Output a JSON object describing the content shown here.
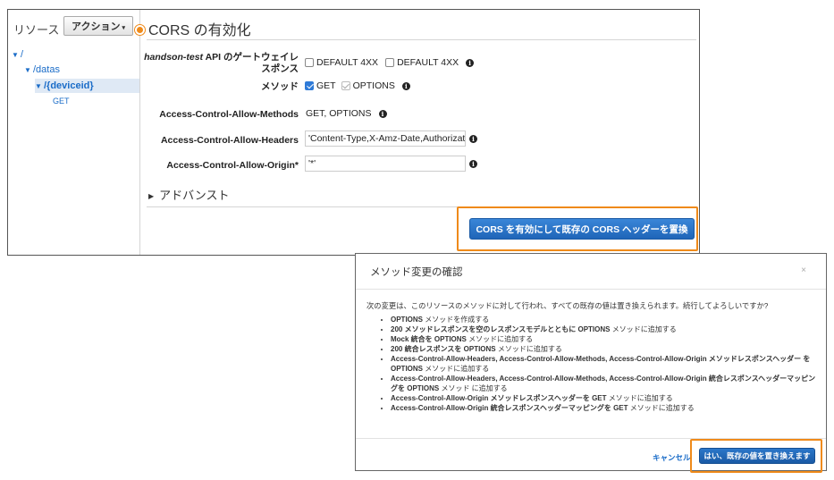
{
  "resources": {
    "title": "リソース",
    "action_button": "アクション",
    "tree": [
      {
        "label": "/"
      },
      {
        "label": "/datas"
      },
      {
        "label": "/{deviceid}"
      },
      {
        "label": "GET"
      }
    ]
  },
  "cors": {
    "title": "CORS の有効化",
    "gateway_label_em": "handson-test",
    "gateway_label_rest": " API のゲートウェイレスポンス",
    "default4xx_a": "DEFAULT 4XX",
    "default4xx_b": "DEFAULT 4XX",
    "method_label": "メソッド",
    "method_get": "GET",
    "method_options": "OPTIONS",
    "allow_methods_label": "Access-Control-Allow-Methods",
    "allow_methods_value": "GET, OPTIONS",
    "allow_headers_label": "Access-Control-Allow-Headers",
    "allow_headers_value": "'Content-Type,X-Amz-Date,Authorization,X-Api-Key,X-Amz-Security-Token'",
    "allow_origin_label": "Access-Control-Allow-Origin*",
    "allow_origin_value": "'*'",
    "advanced": "アドバンスト",
    "enable_button": "CORS を有効にして既存の CORS ヘッダーを置換",
    "info_glyph": "i"
  },
  "modal": {
    "title": "メソッド変更の確認",
    "close": "×",
    "description": "次の変更は、このリソースのメソッドに対して行われ、すべての既存の値は置き換えられます。続行してよろしいですか?",
    "items": [
      {
        "b": "OPTIONS",
        "t": " メソッドを作成する"
      },
      {
        "b": "200 メソッドレスポンスを空のレスポンスモデルとともに OPTIONS",
        "t": " メソッドに追加する"
      },
      {
        "b": "Mock 統合を OPTIONS",
        "t": " メソッドに追加する"
      },
      {
        "b": "200 統合レスポンスを OPTIONS",
        "t": " メソッドに追加する"
      },
      {
        "b": "Access-Control-Allow-Headers, Access-Control-Allow-Methods, Access-Control-Allow-Origin メソッドレスポンスヘッダー を OPTIONS",
        "t": " メソッドに追加する"
      },
      {
        "b": "Access-Control-Allow-Headers, Access-Control-Allow-Methods, Access-Control-Allow-Origin 統合レスポンスヘッダーマッピングを OPTIONS",
        "t": " メソッド に追加する"
      },
      {
        "b": "Access-Control-Allow-Origin メソッドレスポンスヘッダーを GET",
        "t": " メソッドに追加する"
      },
      {
        "b": "Access-Control-Allow-Origin 統合レスポンスヘッダーマッピングを GET",
        "t": " メソッドに追加する"
      }
    ],
    "cancel": "キャンセル",
    "confirm": "はい、既存の値を置き換えます"
  }
}
